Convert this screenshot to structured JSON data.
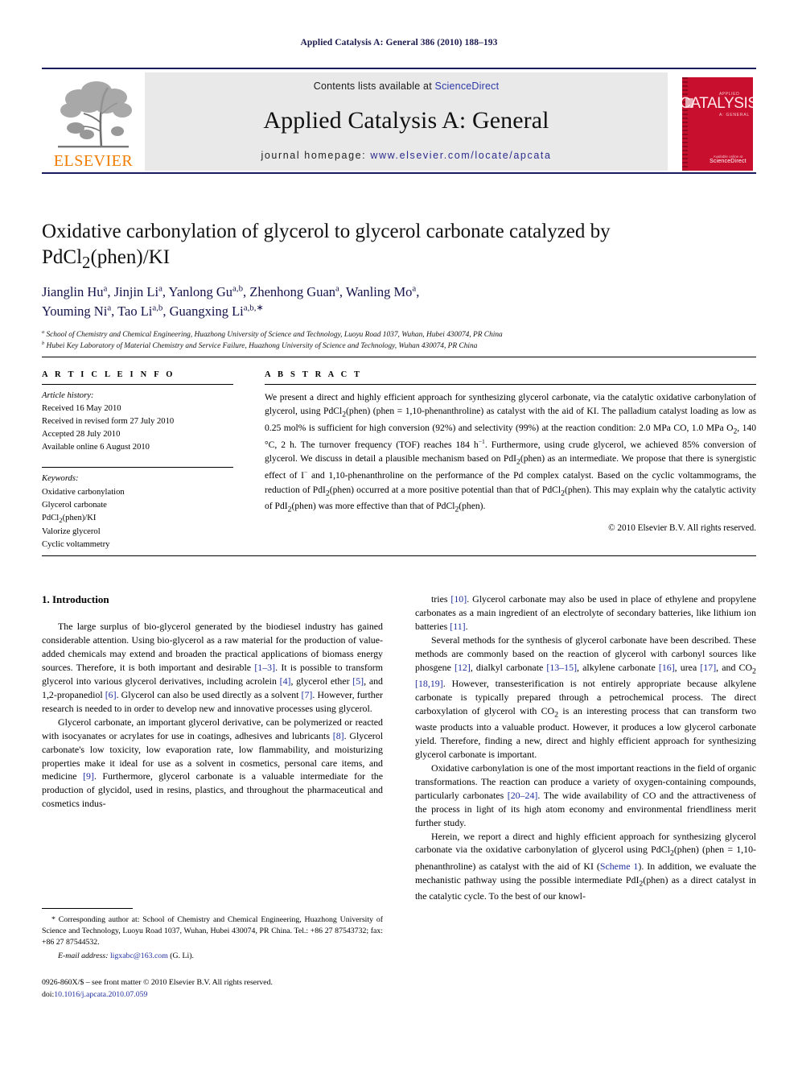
{
  "running_head": "Applied Catalysis A: General 386 (2010) 188–193",
  "masthead": {
    "publisher_name": "ELSEVIER",
    "contents_prefix": "Contents lists available at ",
    "contents_link": "ScienceDirect",
    "journal_title": "Applied Catalysis A: General",
    "homepage_prefix": "journal homepage: ",
    "homepage_url": "www.elsevier.com/locate/apcata",
    "cover": {
      "applied": "APPLIED",
      "catalysis": "CATALYSIS",
      "general": "A: GENERAL",
      "footer_small": "Available online at",
      "footer_big": "ScienceDirect"
    }
  },
  "article": {
    "title_line1": "Oxidative carbonylation of glycerol to glycerol carbonate catalyzed by",
    "title_line2_a": "PdCl",
    "title_line2_sub": "2",
    "title_line2_b": "(phen)/KI",
    "authors_line1": "Jianglin Hu<sup>a</sup>, Jinjin Li<sup>a</sup>, Yanlong Gu<sup>a,b</sup>, Zhenhong Guan<sup>a</sup>, Wanling Mo<sup>a</sup>,",
    "authors_line2": "Youming Ni<sup>a</sup>, Tao Li<sup>a,b</sup>, Guangxing Li<sup>a,b,∗</sup>",
    "affiliation_a": "<sup>a</sup> School of Chemistry and Chemical Engineering, Huazhong University of Science and Technology, Luoyu Road 1037, Wuhan, Hubei 430074, PR China",
    "affiliation_b": "<sup>b</sup> Hubei Key Laboratory of Material Chemistry and Service Failure, Huazhong University of Science and Technology, Wuhan 430074, PR China"
  },
  "sections": {
    "article_info_header": "A R T I C L E    I N F O",
    "abstract_header": "A B S T R A C T"
  },
  "article_info": {
    "history_label": "Article history:",
    "history": [
      "Received 16 May 2010",
      "Received in revised form 27 July 2010",
      "Accepted 28 July 2010",
      "Available online 6 August 2010"
    ],
    "keywords_label": "Keywords:",
    "keywords": [
      "Oxidative carbonylation",
      "Glycerol carbonate",
      "PdCl<sub>2</sub>(phen)/KI",
      "Valorize glycerol",
      "Cyclic voltammetry"
    ]
  },
  "abstract": {
    "text": "We present a direct and highly efficient approach for synthesizing glycerol carbonate, via the catalytic oxidative carbonylation of glycerol, using PdCl<sub>2</sub>(phen) (phen = 1,10-phenanthroline) as catalyst with the aid of KI. The palladium catalyst loading as low as 0.25 mol% is sufficient for high conversion (92%) and selectivity (99%) at the reaction condition: 2.0 MPa CO, 1.0 MPa O<sub>2</sub>, 140 °C, 2 h. The turnover frequency (TOF) reaches 184 h<sup>−1</sup>. Furthermore, using crude glycerol, we achieved 85% conversion of glycerol. We discuss in detail a plausible mechanism based on PdI<sub>2</sub>(phen) as an intermediate. We propose that there is synergistic effect of I<sup>−</sup> and 1,10-phenanthroline on the performance of the Pd complex catalyst. Based on the cyclic voltammograms, the reduction of PdI<sub>2</sub>(phen) occurred at a more positive potential than that of PdCl<sub>2</sub>(phen). This may explain why the catalytic activity of PdI<sub>2</sub>(phen) was more effective than that of PdCl<sub>2</sub>(phen).",
    "copyright": "© 2010 Elsevier B.V. All rights reserved."
  },
  "body": {
    "intro_heading": "1.  Introduction",
    "left_paragraphs": [
      "The large surplus of bio-glycerol generated by the biodiesel industry has gained considerable attention. Using bio-glycerol as a raw material for the production of value-added chemicals may extend and broaden the practical applications of biomass energy sources. Therefore, it is both important and desirable <a class=\"ref\">[1–3]</a>. It is possible to transform glycerol into various glycerol derivatives, including acrolein <a class=\"ref\">[4]</a>, glycerol ether <a class=\"ref\">[5]</a>, and 1,2-propanediol <a class=\"ref\">[6]</a>. Glycerol can also be used directly as a solvent <a class=\"ref\">[7]</a>. However, further research is needed to in order to develop new and innovative processes using glycerol.",
      "Glycerol carbonate, an important glycerol derivative, can be polymerized or reacted with isocyanates or acrylates for use in coatings, adhesives and lubricants <a class=\"ref\">[8]</a>. Glycerol carbonate's low toxicity, low evaporation rate, low flammability, and moisturizing properties make it ideal for use as a solvent in cosmetics, personal care items, and medicine <a class=\"ref\">[9]</a>. Furthermore, glycerol carbonate is a valuable intermediate for the production of glycidol, used in resins, plastics, and throughout the pharmaceutical and cosmetics indus-"
    ],
    "right_paragraphs": [
      "tries <a class=\"ref\">[10]</a>. Glycerol carbonate may also be used in place of ethylene and propylene carbonates as a main ingredient of an electrolyte of secondary batteries, like lithium ion batteries <a class=\"ref\">[11]</a>.",
      "Several methods for the synthesis of glycerol carbonate have been described. These methods are commonly based on the reaction of glycerol with carbonyl sources like phosgene <a class=\"ref\">[12]</a>, dialkyl carbonate <a class=\"ref\">[13–15]</a>, alkylene carbonate <a class=\"ref\">[16]</a>, urea <a class=\"ref\">[17]</a>, and CO<sub>2</sub> <a class=\"ref\">[18,19]</a>. However, transesterification is not entirely appropriate because alkylene carbonate is typically prepared through a petrochemical process. The direct carboxylation of glycerol with CO<sub>2</sub> is an interesting process that can transform two waste products into a valuable product. However, it produces a low glycerol carbonate yield. Therefore, finding a new, direct and highly efficient approach for synthesizing glycerol carbonate is important.",
      "Oxidative carbonylation is one of the most important reactions in the field of organic transformations. The reaction can produce a variety of oxygen-containing compounds, particularly carbonates <a class=\"ref\">[20–24]</a>. The wide availability of CO and the attractiveness of the process in light of its high atom economy and environmental friendliness merit further study.",
      "Herein, we report a direct and highly efficient approach for synthesizing glycerol carbonate via the oxidative carbonylation of glycerol using PdCl<sub>2</sub>(phen) (phen = 1,10-phenanthroline) as catalyst with the aid of KI (<a class=\"ref\">Scheme 1</a>). In addition, we evaluate the mechanistic pathway using the possible intermediate PdI<sub>2</sub>(phen) as a direct catalyst in the catalytic cycle. To the best of our knowl-"
    ]
  },
  "footnote": {
    "corresponding": "* Corresponding author at: School of Chemistry and Chemical Engineering, Huazhong University of Science and Technology, Luoyu Road 1037, Wuhan, Hubei 430074, PR China. Tel.: +86 27 87543732; fax: +86 27 87544532.",
    "email_label": "E-mail address:",
    "email": "ligxabc@163.com",
    "email_suffix": "(G. Li).",
    "imprint_line1": "0926-860X/$ – see front matter © 2010 Elsevier B.V. All rights reserved.",
    "imprint_doi_label": "doi:",
    "imprint_doi": "10.1016/j.apcata.2010.07.059"
  },
  "colors": {
    "link": "#2c38a8",
    "ref": "#1f2f9e",
    "journal_navy": "#1a1a5e",
    "elsevier_orange": "#F07C00",
    "cover_red": "#c8102e",
    "band_gray": "#e9e9e9"
  }
}
